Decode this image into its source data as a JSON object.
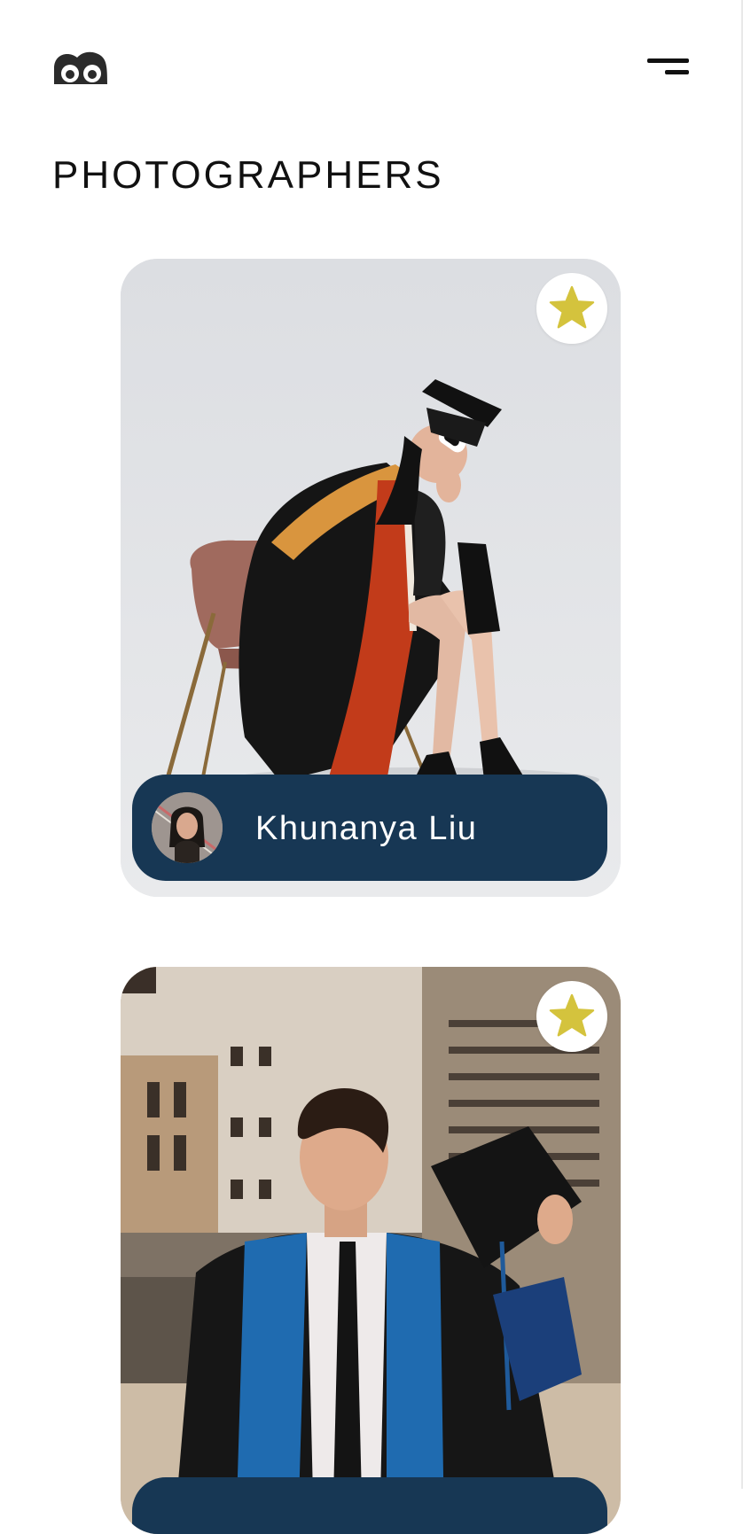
{
  "app": {
    "logo_icon": "owl-eyes-logo-icon",
    "menu_icon": "hamburger-menu-icon"
  },
  "page": {
    "title": "PHOTOGRAPHERS"
  },
  "photographers": [
    {
      "name": "Khunanya Liu",
      "favorite_icon": "star-icon",
      "favorite_color": "#d4c33d",
      "photo_subject": "graduate-seated-on-chair"
    },
    {
      "name": "",
      "favorite_icon": "star-icon",
      "favorite_color": "#d4c33d",
      "photo_subject": "graduate-holding-cap"
    }
  ],
  "colors": {
    "name_bar": "#173754",
    "star": "#d4c33d",
    "text_dark": "#111111"
  }
}
